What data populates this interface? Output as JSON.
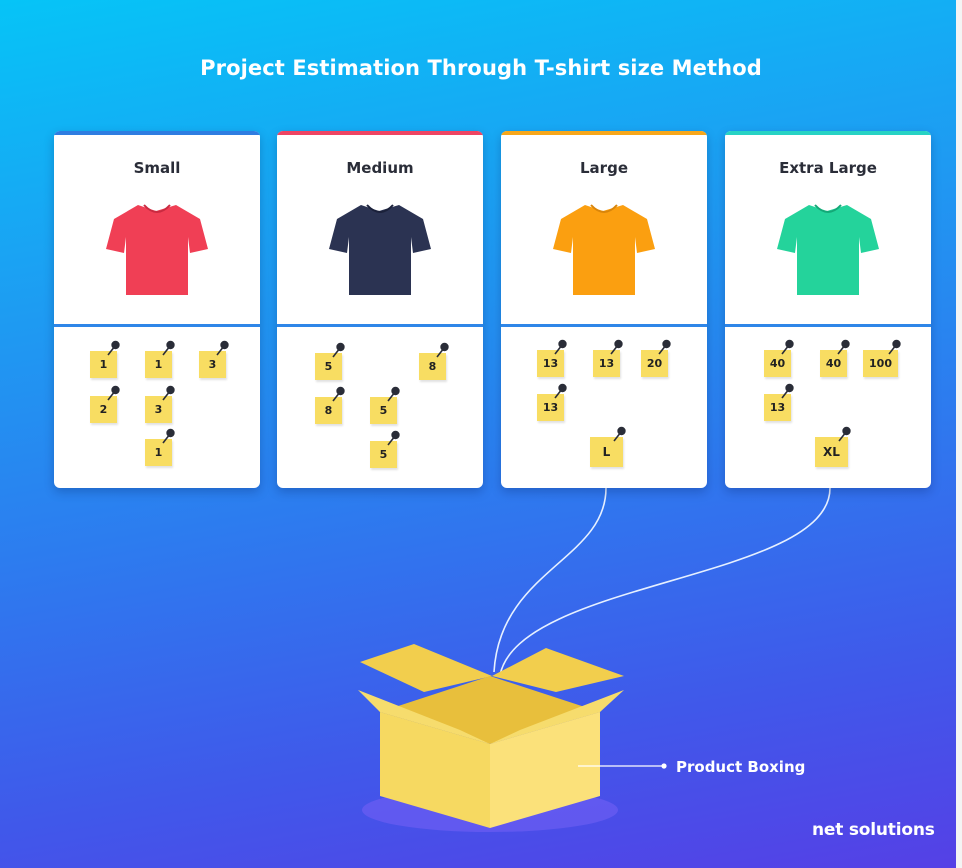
{
  "title": "Project Estimation Through T-shirt size Method",
  "cards": [
    {
      "label": "Small",
      "accent": "#2f7de1",
      "shirt_color": "#f03f55",
      "notes": [
        "1",
        "1",
        "3",
        "2",
        "3",
        "1"
      ]
    },
    {
      "label": "Medium",
      "accent": "#ee4563",
      "shirt_color": "#2b3352",
      "notes": [
        "5",
        "8",
        "8",
        "5",
        "5"
      ]
    },
    {
      "label": "Large",
      "accent": "#f7a71b",
      "shirt_color": "#fb9f10",
      "notes": [
        "13",
        "13",
        "20",
        "13",
        "L"
      ]
    },
    {
      "label": "Extra Large",
      "accent": "#27d3c4",
      "shirt_color": "#24d39b",
      "notes": [
        "40",
        "40",
        "100",
        "13",
        "XL"
      ]
    }
  ],
  "callout": "Product Boxing",
  "logo": "net solutions",
  "colors": {
    "note": "#f8dd62",
    "box": "#f6d961",
    "background_top": "#06c4f7",
    "background_bottom": "#5540e6"
  },
  "icons": [
    "t-shirt-icon",
    "push-pin-icon",
    "open-box-icon"
  ]
}
